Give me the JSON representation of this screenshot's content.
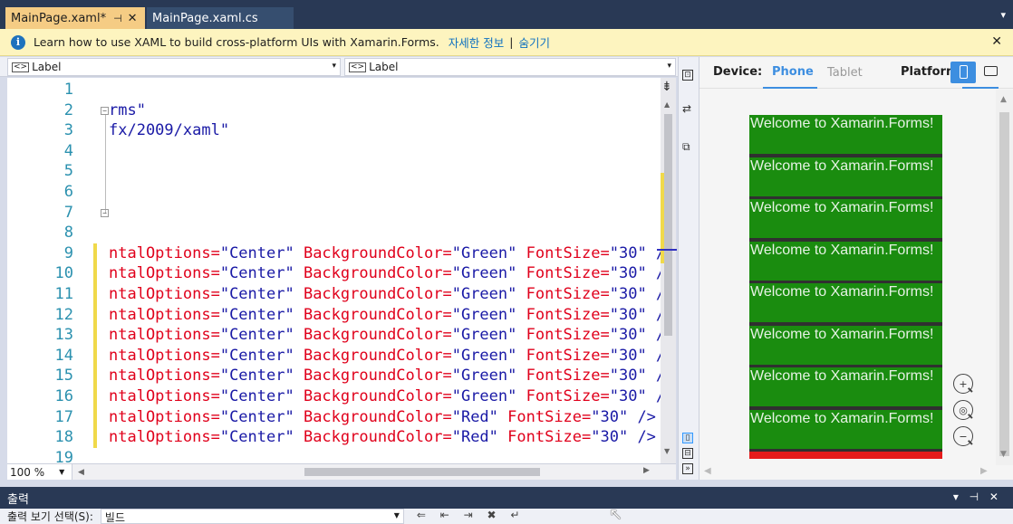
{
  "tabs": [
    {
      "label": "MainPage.xaml*",
      "active": true,
      "pin": "⊣",
      "close": "✕"
    },
    {
      "label": "MainPage.xaml.cs",
      "active": false
    }
  ],
  "infobar": {
    "message": "Learn how to use XAML to build cross-platform UIs with Xamarin.Forms.",
    "learn_more": "자세한 정보",
    "separator": "|",
    "hide": "숨기기",
    "close": "✕"
  },
  "nav": {
    "left_combo": "Label",
    "right_combo": "Label",
    "tag_icon": "<>",
    "arrow": "▾"
  },
  "editor": {
    "lines": [
      {
        "n": "1",
        "code": []
      },
      {
        "n": "2",
        "code": [
          {
            "t": "rms\"",
            "c": "val"
          }
        ],
        "fold": "−"
      },
      {
        "n": "3",
        "code": [
          {
            "t": "fx/2009/xaml\"",
            "c": "val"
          }
        ]
      },
      {
        "n": "4",
        "code": []
      },
      {
        "n": "5",
        "code": []
      },
      {
        "n": "6",
        "code": []
      },
      {
        "n": "7",
        "code": [],
        "fold": "−"
      },
      {
        "n": "8",
        "code": []
      },
      {
        "n": "9",
        "changed": true,
        "code": [
          {
            "t": "ntalOptions=",
            "c": "attr"
          },
          {
            "t": "\"Center\" ",
            "c": "val"
          },
          {
            "t": "BackgroundColor=",
            "c": "attr"
          },
          {
            "t": "\"Green\" ",
            "c": "val"
          },
          {
            "t": "FontSize=",
            "c": "attr"
          },
          {
            "t": "\"30\" /",
            "c": "val"
          }
        ]
      },
      {
        "n": "10",
        "changed": true,
        "code": [
          {
            "t": "ntalOptions=",
            "c": "attr"
          },
          {
            "t": "\"Center\" ",
            "c": "val"
          },
          {
            "t": "BackgroundColor=",
            "c": "attr"
          },
          {
            "t": "\"Green\" ",
            "c": "val"
          },
          {
            "t": "FontSize=",
            "c": "attr"
          },
          {
            "t": "\"30\" /",
            "c": "val"
          }
        ]
      },
      {
        "n": "11",
        "changed": true,
        "code": [
          {
            "t": "ntalOptions=",
            "c": "attr"
          },
          {
            "t": "\"Center\" ",
            "c": "val"
          },
          {
            "t": "BackgroundColor=",
            "c": "attr"
          },
          {
            "t": "\"Green\" ",
            "c": "val"
          },
          {
            "t": "FontSize=",
            "c": "attr"
          },
          {
            "t": "\"30\" /",
            "c": "val"
          }
        ]
      },
      {
        "n": "12",
        "changed": true,
        "code": [
          {
            "t": "ntalOptions=",
            "c": "attr"
          },
          {
            "t": "\"Center\" ",
            "c": "val"
          },
          {
            "t": "BackgroundColor=",
            "c": "attr"
          },
          {
            "t": "\"Green\" ",
            "c": "val"
          },
          {
            "t": "FontSize=",
            "c": "attr"
          },
          {
            "t": "\"30\" /",
            "c": "val"
          }
        ]
      },
      {
        "n": "13",
        "changed": true,
        "code": [
          {
            "t": "ntalOptions=",
            "c": "attr"
          },
          {
            "t": "\"Center\" ",
            "c": "val"
          },
          {
            "t": "BackgroundColor=",
            "c": "attr"
          },
          {
            "t": "\"Green\" ",
            "c": "val"
          },
          {
            "t": "FontSize=",
            "c": "attr"
          },
          {
            "t": "\"30\" /",
            "c": "val"
          }
        ]
      },
      {
        "n": "14",
        "changed": true,
        "code": [
          {
            "t": "ntalOptions=",
            "c": "attr"
          },
          {
            "t": "\"Center\" ",
            "c": "val"
          },
          {
            "t": "BackgroundColor=",
            "c": "attr"
          },
          {
            "t": "\"Green\" ",
            "c": "val"
          },
          {
            "t": "FontSize=",
            "c": "attr"
          },
          {
            "t": "\"30\" /",
            "c": "val"
          }
        ]
      },
      {
        "n": "15",
        "changed": true,
        "code": [
          {
            "t": "ntalOptions=",
            "c": "attr"
          },
          {
            "t": "\"Center\" ",
            "c": "val"
          },
          {
            "t": "BackgroundColor=",
            "c": "attr"
          },
          {
            "t": "\"Green\" ",
            "c": "val"
          },
          {
            "t": "FontSize=",
            "c": "attr"
          },
          {
            "t": "\"30\" /",
            "c": "val"
          }
        ]
      },
      {
        "n": "16",
        "changed": true,
        "code": [
          {
            "t": "ntalOptions=",
            "c": "attr"
          },
          {
            "t": "\"Center\" ",
            "c": "val"
          },
          {
            "t": "BackgroundColor=",
            "c": "attr"
          },
          {
            "t": "\"Green\" ",
            "c": "val"
          },
          {
            "t": "FontSize=",
            "c": "attr"
          },
          {
            "t": "\"30\" /",
            "c": "val"
          }
        ]
      },
      {
        "n": "17",
        "changed": true,
        "code": [
          {
            "t": "ntalOptions=",
            "c": "attr"
          },
          {
            "t": "\"Center\" ",
            "c": "val"
          },
          {
            "t": "BackgroundColor=",
            "c": "attr"
          },
          {
            "t": "\"Red\" ",
            "c": "val"
          },
          {
            "t": "FontSize=",
            "c": "attr"
          },
          {
            "t": "\"30\" />",
            "c": "val"
          }
        ]
      },
      {
        "n": "18",
        "changed": true,
        "code": [
          {
            "t": "ntalOptions=",
            "c": "attr"
          },
          {
            "t": "\"Center\" ",
            "c": "val"
          },
          {
            "t": "BackgroundColor=",
            "c": "attr"
          },
          {
            "t": "\"Red\" ",
            "c": "val"
          },
          {
            "t": "FontSize=",
            "c": "attr"
          },
          {
            "t": "\"30\" />",
            "c": "val"
          }
        ]
      },
      {
        "n": "19",
        "code": []
      }
    ],
    "zoom": "100 %"
  },
  "previewer": {
    "device_label": "Device:",
    "phone": "Phone",
    "tablet": "Tablet",
    "platform": "Platform",
    "labels": [
      {
        "text": "Welcome to Xamarin.Forms!",
        "color": "#1a8c0f"
      },
      {
        "text": "Welcome to Xamarin.Forms!",
        "color": "#1a8c0f"
      },
      {
        "text": "Welcome to Xamarin.Forms!",
        "color": "#1a8c0f"
      },
      {
        "text": "Welcome to Xamarin.Forms!",
        "color": "#1a8c0f"
      },
      {
        "text": "Welcome to Xamarin.Forms!",
        "color": "#1a8c0f"
      },
      {
        "text": "Welcome to Xamarin.Forms!",
        "color": "#1a8c0f"
      },
      {
        "text": "Welcome to Xamarin.Forms!",
        "color": "#1a8c0f"
      },
      {
        "text": "Welcome to Xamarin.Forms!",
        "color": "#1a8c0f"
      },
      {
        "text": "",
        "color": "#e51b1b"
      }
    ],
    "zoom_in": "+",
    "zoom_fit": "◎",
    "zoom_out": "−"
  },
  "output": {
    "title": "출력",
    "ctrls": "▾ ⊣ ✕",
    "show_output_from": "출력 보기 선택(S):",
    "source": "빌드"
  }
}
